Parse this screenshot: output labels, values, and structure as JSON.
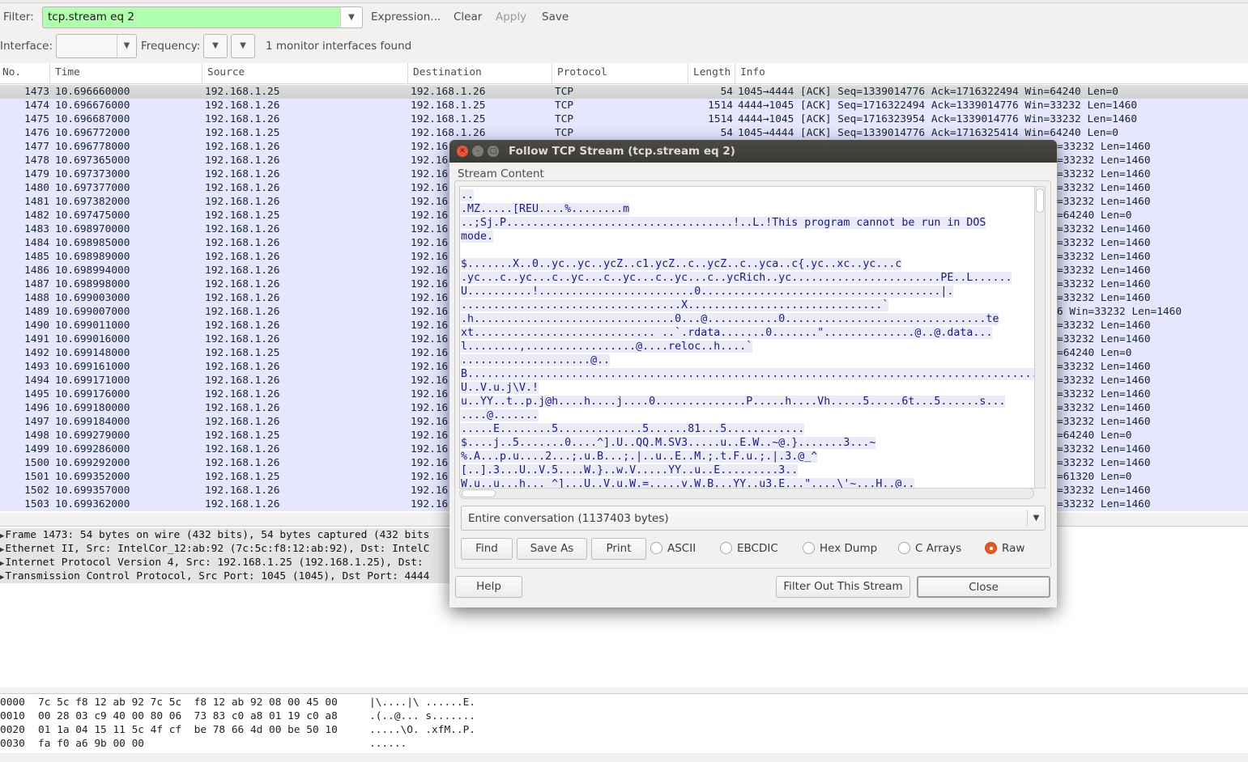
{
  "toolbar": {
    "filter_label": "Filter:",
    "filter_value": "tcp.stream eq 2",
    "expression": "Expression...",
    "clear": "Clear",
    "apply": "Apply",
    "save": "Save",
    "interface_label": "Interface:",
    "frequency_label": "Frequency:",
    "monitor_status": "1 monitor interfaces found",
    "filter_valid_color": "#afffaf"
  },
  "packet_list": {
    "columns": [
      "No.",
      "Time",
      "Source",
      "Destination",
      "Protocol",
      "Length",
      "Info"
    ],
    "row_color": "#e6e6ff",
    "rows": [
      {
        "no": "1473",
        "time": "10.696660000",
        "src": "192.168.1.25",
        "dst": "192.168.1.26",
        "proto": "TCP",
        "len": "54",
        "info": "1045→4444 [ACK] Seq=1339014776 Ack=1716322494 Win=64240 Len=0",
        "selected": true
      },
      {
        "no": "1474",
        "time": "10.696676000",
        "src": "192.168.1.26",
        "dst": "192.168.1.25",
        "proto": "TCP",
        "len": "1514",
        "info": "4444→1045 [ACK] Seq=1716322494 Ack=1339014776 Win=33232 Len=1460"
      },
      {
        "no": "1475",
        "time": "10.696687000",
        "src": "192.168.1.26",
        "dst": "192.168.1.25",
        "proto": "TCP",
        "len": "1514",
        "info": "4444→1045 [ACK] Seq=1716323954 Ack=1339014776 Win=33232 Len=1460"
      },
      {
        "no": "1476",
        "time": "10.696772000",
        "src": "192.168.1.25",
        "dst": "192.168.1.26",
        "proto": "TCP",
        "len": "54",
        "info": "1045→4444 [ACK] Seq=1339014776 Ack=1716325414 Win=64240 Len=0"
      },
      {
        "no": "1477",
        "time": "10.696778000",
        "src": "192.168.1.26",
        "dst": "192.16",
        "info_tail": "=33232 Len=1460"
      },
      {
        "no": "1478",
        "time": "10.697365000",
        "src": "192.168.1.26",
        "dst": "192.16",
        "info_tail": "=33232 Len=1460"
      },
      {
        "no": "1479",
        "time": "10.697373000",
        "src": "192.168.1.26",
        "dst": "192.16",
        "info_tail": "=33232 Len=1460"
      },
      {
        "no": "1480",
        "time": "10.697377000",
        "src": "192.168.1.26",
        "dst": "192.16",
        "info_tail": "=33232 Len=1460"
      },
      {
        "no": "1481",
        "time": "10.697382000",
        "src": "192.168.1.26",
        "dst": "192.16",
        "info_tail": "=33232 Len=1460"
      },
      {
        "no": "1482",
        "time": "10.697475000",
        "src": "192.168.1.25",
        "dst": "192.16",
        "info_tail": "=64240 Len=0"
      },
      {
        "no": "1483",
        "time": "10.698970000",
        "src": "192.168.1.26",
        "dst": "192.16",
        "info_tail": "=33232 Len=1460"
      },
      {
        "no": "1484",
        "time": "10.698985000",
        "src": "192.168.1.26",
        "dst": "192.16",
        "info_tail": "=33232 Len=1460"
      },
      {
        "no": "1485",
        "time": "10.698989000",
        "src": "192.168.1.26",
        "dst": "192.16",
        "info_tail": "=33232 Len=1460"
      },
      {
        "no": "1486",
        "time": "10.698994000",
        "src": "192.168.1.26",
        "dst": "192.16",
        "info_tail": "=33232 Len=1460"
      },
      {
        "no": "1487",
        "time": "10.698998000",
        "src": "192.168.1.26",
        "dst": "192.16",
        "info_tail": "=33232 Len=1460"
      },
      {
        "no": "1488",
        "time": "10.699003000",
        "src": "192.168.1.26",
        "dst": "192.16",
        "info_tail": "=33232 Len=1460"
      },
      {
        "no": "1489",
        "time": "10.699007000",
        "src": "192.168.1.26",
        "dst": "192.16",
        "info_tail": "6 Win=33232 Len=1460"
      },
      {
        "no": "1490",
        "time": "10.699011000",
        "src": "192.168.1.26",
        "dst": "192.16",
        "info_tail": "=33232 Len=1460"
      },
      {
        "no": "1491",
        "time": "10.699016000",
        "src": "192.168.1.26",
        "dst": "192.16",
        "info_tail": "=33232 Len=1460"
      },
      {
        "no": "1492",
        "time": "10.699148000",
        "src": "192.168.1.25",
        "dst": "192.16",
        "info_tail": "=64240 Len=0"
      },
      {
        "no": "1493",
        "time": "10.699161000",
        "src": "192.168.1.26",
        "dst": "192.16",
        "info_tail": "=33232 Len=1460"
      },
      {
        "no": "1494",
        "time": "10.699171000",
        "src": "192.168.1.26",
        "dst": "192.16",
        "info_tail": "=33232 Len=1460"
      },
      {
        "no": "1495",
        "time": "10.699176000",
        "src": "192.168.1.26",
        "dst": "192.16",
        "info_tail": "=33232 Len=1460"
      },
      {
        "no": "1496",
        "time": "10.699180000",
        "src": "192.168.1.26",
        "dst": "192.16",
        "info_tail": "=33232 Len=1460"
      },
      {
        "no": "1497",
        "time": "10.699184000",
        "src": "192.168.1.26",
        "dst": "192.16",
        "info_tail": "=33232 Len=1460"
      },
      {
        "no": "1498",
        "time": "10.699279000",
        "src": "192.168.1.25",
        "dst": "192.16",
        "info_tail": "=64240 Len=0"
      },
      {
        "no": "1499",
        "time": "10.699286000",
        "src": "192.168.1.26",
        "dst": "192.16",
        "info_tail": "=33232 Len=1460"
      },
      {
        "no": "1500",
        "time": "10.699292000",
        "src": "192.168.1.26",
        "dst": "192.16",
        "info_tail": "=33232 Len=1460"
      },
      {
        "no": "1501",
        "time": "10.699352000",
        "src": "192.168.1.25",
        "dst": "192.16",
        "info_tail": "=61320 Len=0"
      },
      {
        "no": "1502",
        "time": "10.699357000",
        "src": "192.168.1.26",
        "dst": "192.16",
        "info_tail": "=33232 Len=1460"
      },
      {
        "no": "1503",
        "time": "10.699362000",
        "src": "192.168.1.26",
        "dst": "192.16",
        "info_tail": "=33232 Len=1460"
      }
    ]
  },
  "details": [
    "Frame 1473: 54 bytes on wire (432 bits), 54 bytes captured (432 bits",
    "Ethernet II, Src: IntelCor_12:ab:92 (7c:5c:f8:12:ab:92), Dst: IntelC",
    "Internet Protocol Version 4, Src: 192.168.1.25 (192.168.1.25), Dst: ",
    "Transmission Control Protocol, Src Port: 1045 (1045), Dst Port: 4444"
  ],
  "hex_dump": [
    {
      "offset": "0000",
      "bytes": "7c 5c f8 12 ab 92 7c 5c  f8 12 ab 92 08 00 45 00",
      "ascii": "|\\....|\\ ......E."
    },
    {
      "offset": "0010",
      "bytes": "00 28 03 c9 40 00 80 06  73 83 c0 a8 01 19 c0 a8",
      "ascii": ".(..@... s......."
    },
    {
      "offset": "0020",
      "bytes": "01 1a 04 15 11 5c 4f cf  be 78 66 4d 00 be 50 10",
      "ascii": ".....\\O. .xfM..P."
    },
    {
      "offset": "0030",
      "bytes": "fa f0 a6 9b 00 00",
      "ascii": "......"
    }
  ],
  "dialog": {
    "title": "Follow TCP Stream (tcp.stream eq 2)",
    "frame_label": "Stream Content",
    "stream_lines": [
      "..",
      ".MZ.....[REU....%........m",
      "..;Sj.P...................................!..L.!This program cannot be run in DOS",
      "mode.",
      "",
      "$.......X..0..yc..yc..ycZ..c1.ycZ..c..ycZ..c..yca..c{.yc..xc..yc...c",
      ".yc...c..yc...c..yc...c..yc...c..yc...c..ycRich..yc.......................PE..L......",
      "U..........!........................0.....................................|.",
      "..................................X..............................`",
      ".h...............................0...@...........0...............................te",
      "xt............................ ..`.rdata.......0.......\"..............@..@.data...",
      "l........,.................@....reloc..h....`",
      "....................@..",
      "B.........................................................................................",
      "U..V.u.j\\V.!",
      "u..YY..t..p.j@h....h....j....0..............P.....h....Vh.....5.....6t...5......s...",
      "....@.......",
      ".....E........5.............5......81...5............",
      "$....j..5.......0....^].U..QQ.M.SV3.....u..E.W..~@.}.......3...~",
      "%.A...p.u....2...;.u.B...;.|..u..E..M.;.t.F.u.;.|.3.@_^",
      "[..].3...U..V.5....W.}..w.V.....YY..u..E.........3..",
      "W.u..u...h... ^]...U..V.u.W.=.....v.W.B...YY..u3.E...\"....\\'~...H..@.."
    ],
    "conversation_select": "Entire conversation (1137403 bytes)",
    "find": "Find",
    "save_as": "Save As",
    "print": "Print",
    "formats": [
      {
        "label": "ASCII",
        "selected": false
      },
      {
        "label": "EBCDIC",
        "selected": false
      },
      {
        "label": "Hex Dump",
        "selected": false
      },
      {
        "label": "C Arrays",
        "selected": false
      },
      {
        "label": "Raw",
        "selected": true
      }
    ],
    "help": "Help",
    "filter_out": "Filter Out This Stream",
    "close": "Close",
    "accent_color": "#e05a2b"
  }
}
